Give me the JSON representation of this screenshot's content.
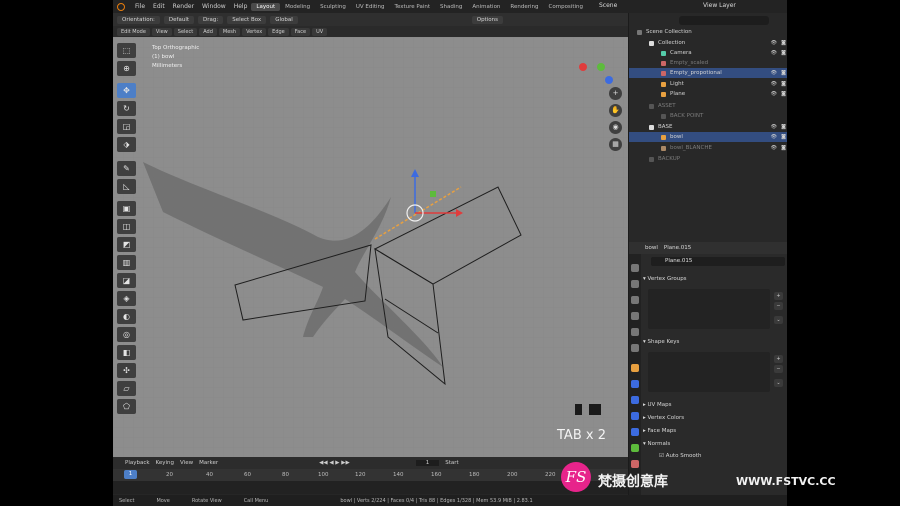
{
  "top_menu": {
    "items": [
      "File",
      "Edit",
      "Render",
      "Window",
      "Help"
    ],
    "workspaces": [
      "Layout",
      "Modeling",
      "Sculpting",
      "UV Editing",
      "Texture Paint",
      "Shading",
      "Animation",
      "Rendering",
      "Compositing"
    ],
    "scene": "Scene",
    "view_layer": "View Layer"
  },
  "header": {
    "orientation": "Orientation:",
    "orientation_value": "Default",
    "drag": "Drag:",
    "drag_value": "Select Box",
    "pivot": "Global",
    "options": "Options"
  },
  "mode_bar": {
    "mode": "Edit Mode",
    "items": [
      "View",
      "Select",
      "Add",
      "Mesh",
      "Vertex",
      "Edge",
      "Face",
      "UV"
    ]
  },
  "viewport": {
    "overlay_line1": "Top Orthographic",
    "overlay_line2": "(1) bowl",
    "overlay_line3": "Millimeters",
    "keystroke": "TAB x 2"
  },
  "timeline": {
    "menu": [
      "Playback",
      "Keying",
      "View",
      "Marker"
    ],
    "current_frame": "1",
    "start_label": "Start",
    "ruler": [
      "1",
      "20",
      "40",
      "60",
      "80",
      "100",
      "120",
      "140",
      "160",
      "180",
      "200",
      "220"
    ]
  },
  "statusbar": {
    "select": "Select",
    "move": "Move",
    "rotate": "Rotate View",
    "call_menu": "Call Menu",
    "stats": "bowl | Verts 2/224 | Faces 0/4 | Tris 88 | Edges 1/328 | Mem 53.9 MiB | 2.83.1"
  },
  "outliner": {
    "rows": [
      {
        "label": "Scene Collection",
        "dim": false,
        "sel": false,
        "indent": 8
      },
      {
        "label": "Collection",
        "dim": false,
        "sel": false,
        "indent": 20
      },
      {
        "label": "Camera",
        "dim": false,
        "sel": false,
        "indent": 32
      },
      {
        "label": "Empty_scaled",
        "dim": true,
        "sel": false,
        "indent": 32
      },
      {
        "label": "Empty_propotional",
        "dim": true,
        "sel": true,
        "indent": 32
      },
      {
        "label": "Light",
        "dim": false,
        "sel": false,
        "indent": 32
      },
      {
        "label": "Plane",
        "dim": false,
        "sel": false,
        "indent": 32
      },
      {
        "label": "ASSET",
        "dim": true,
        "sel": false,
        "indent": 20
      },
      {
        "label": "BACK POINT",
        "dim": true,
        "sel": false,
        "indent": 32
      },
      {
        "label": "BASE",
        "dim": false,
        "sel": false,
        "indent": 20
      },
      {
        "label": "bowl",
        "dim": false,
        "sel": true,
        "indent": 32
      },
      {
        "label": "bowl_BLANCHE",
        "dim": true,
        "sel": false,
        "indent": 32
      },
      {
        "label": "BACKUP",
        "dim": true,
        "sel": false,
        "indent": 20
      }
    ]
  },
  "properties": {
    "header_mesh": "bowl",
    "header_plane": "Plane.015",
    "object_name": "Plane.015",
    "panels": [
      "Vertex Groups",
      "Shape Keys",
      "UV Maps",
      "Vertex Colors",
      "Face Maps",
      "Normals"
    ],
    "auto_smooth": "Auto Smooth"
  },
  "watermark": {
    "logo": "FS",
    "text": "梵摄创意库",
    "url": "WWW.FSTVC.CC"
  },
  "colors": {
    "accent_blue": "#4d7fc7",
    "selected_row": "#334d80",
    "blender_orange": "#e87d0d",
    "watermark_pink": "#e7248b"
  }
}
